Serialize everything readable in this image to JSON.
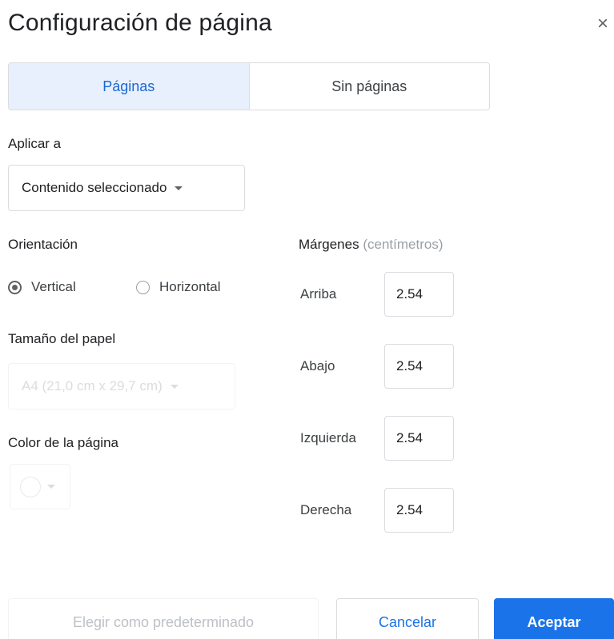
{
  "dialog": {
    "title": "Configuración de página",
    "close_symbol": "×"
  },
  "tabs": [
    {
      "label": "Páginas",
      "active": true
    },
    {
      "label": "Sin páginas",
      "active": false
    }
  ],
  "apply_to": {
    "label": "Aplicar a",
    "value": "Contenido seleccionado"
  },
  "orientation": {
    "label": "Orientación",
    "options": [
      {
        "label": "Vertical",
        "checked": true
      },
      {
        "label": "Horizontal",
        "checked": false
      }
    ]
  },
  "paper_size": {
    "label": "Tamaño del papel",
    "value": "A4 (21,0 cm x 29,7 cm)",
    "disabled": true
  },
  "page_color": {
    "label": "Color de la página",
    "value": "#ffffff",
    "disabled": true
  },
  "margins": {
    "label": "Márgenes",
    "unit_label": "(centímetros)",
    "fields": [
      {
        "label": "Arriba",
        "value": "2.54"
      },
      {
        "label": "Abajo",
        "value": "2.54"
      },
      {
        "label": "Izquierda",
        "value": "2.54"
      },
      {
        "label": "Derecha",
        "value": "2.54"
      }
    ]
  },
  "footer": {
    "default_label": "Elegir como predeterminado",
    "cancel_label": "Cancelar",
    "ok_label": "Aceptar"
  },
  "colors": {
    "accent": "#1a73e8",
    "active_tab_bg": "#e8f0fe"
  }
}
